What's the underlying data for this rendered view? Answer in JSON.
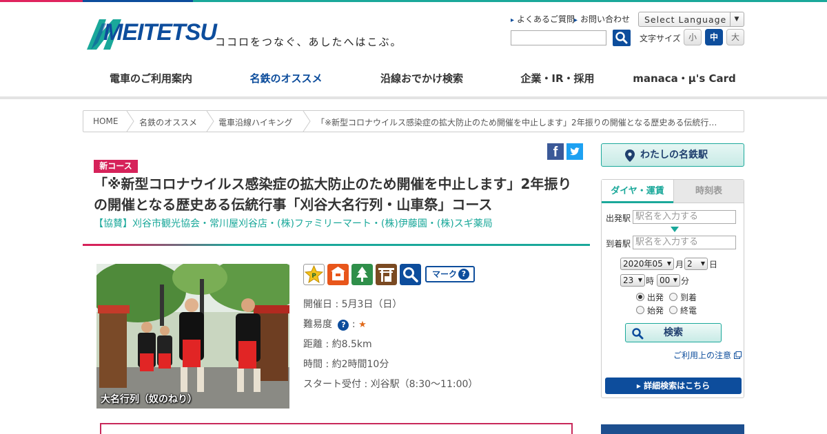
{
  "header": {
    "logo_text": "MEITETSU",
    "tagline": "ココロをつなぐ、あしたへはこぶ。",
    "links": [
      "よくあるご質問",
      "お問い合わせ"
    ],
    "language_select": "Select Language",
    "fontsize_label": "文字サイズ",
    "fontsize_options": [
      "小",
      "中",
      "大"
    ],
    "fontsize_active": "中"
  },
  "nav": {
    "items": [
      "電車のご利用案内",
      "名鉄のオススメ",
      "沿線おでかけ検索",
      "企業・IR・採用",
      "manaca・μ's Card"
    ],
    "active": "名鉄のオススメ"
  },
  "breadcrumb": [
    "HOME",
    "名鉄のオススメ",
    "電車沿線ハイキング",
    "「※新型コロナウイルス感染症の拡大防止のため開催を中止します」2年振りの開催となる歴史ある伝統行…"
  ],
  "article": {
    "badge": "新コース",
    "title": "「※新型コロナウイルス感染症の拡大防止のため開催を中止します」2年振りの開催となる歴史ある伝統行事「刈谷大名行列・山車祭」コース",
    "sponsor": "【協賛】刈谷市観光協会・常川屋刈谷店・(株)ファミリーマート・(株)伊藤園・(株)スギ薬局",
    "photo_caption": "大名行列（奴のねり）",
    "mark_label": "マーク",
    "course_icons": [
      "parking-icon",
      "restaurant-icon",
      "nature-icon",
      "shrine-icon",
      "sightseeing-icon"
    ],
    "date": "開催日 : 5月3日（日）",
    "difficulty_label": "難易度",
    "difficulty_stars": "★",
    "distance": "距離 : 約8.5km",
    "time": "時間 : 約2時間10分",
    "start": "スタート受付 : 刈谷駅（8:30～11:00）"
  },
  "sidebar": {
    "my_station": "わたしの名鉄駅",
    "tabs": [
      "ダイヤ・運賃",
      "時刻表"
    ],
    "departure_label": "出発駅",
    "arrival_label": "到着駅",
    "station_placeholder": "駅名を入力する",
    "year_month": "2020年05",
    "month_unit": "月",
    "day": "2",
    "day_unit": "日",
    "hour": "23",
    "hour_unit": "時",
    "minute": "00",
    "minute_unit": "分",
    "radio_options": [
      "出発",
      "到着",
      "始発",
      "終電"
    ],
    "radio_selected": "出発",
    "search_button": "検索",
    "note_link": "ご利用上の注意",
    "detail_button": "詳細検索はこちら"
  },
  "colors": {
    "brand_blue": "#0d4d9c",
    "accent_teal": "#1aa89a",
    "accent_pink": "#d6225a"
  }
}
